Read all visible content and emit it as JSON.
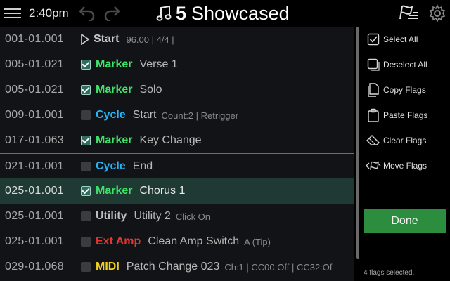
{
  "header": {
    "time": "2:40pm",
    "setlist_number": "5",
    "setlist_title": "Showcased"
  },
  "rows": [
    {
      "time": "001-01.001",
      "type": "Start",
      "type_color": "#c9c9c9",
      "name": "",
      "detail": "96.00 | 4/4 |",
      "checkbox": "none",
      "selected": false
    },
    {
      "time": "005-01.021",
      "type": "Marker",
      "type_color": "#3fe36a",
      "name": "Verse 1",
      "detail": "",
      "checkbox": "checked",
      "selected": false
    },
    {
      "time": "005-01.021",
      "type": "Marker",
      "type_color": "#3fe36a",
      "name": "Solo",
      "detail": "",
      "checkbox": "checked",
      "selected": false
    },
    {
      "time": "009-01.001",
      "type": "Cycle",
      "type_color": "#27b4f5",
      "name": "Start",
      "detail": "Count:2 | Retrigger",
      "checkbox": "unchecked",
      "selected": false
    },
    {
      "time": "017-01.063",
      "type": "Marker",
      "type_color": "#3fe36a",
      "name": "Key Change",
      "detail": "",
      "checkbox": "checked",
      "selected": false
    },
    {
      "time": "021-01.001",
      "type": "Cycle",
      "type_color": "#27b4f5",
      "name": "End",
      "detail": "",
      "checkbox": "unchecked",
      "selected": false
    },
    {
      "time": "025-01.001",
      "type": "Marker",
      "type_color": "#3fe36a",
      "name": "Chorus 1",
      "detail": "",
      "checkbox": "checked",
      "selected": true
    },
    {
      "time": "025-01.001",
      "type": "Utility",
      "type_color": "#bdbdbd",
      "name": "Utility 2",
      "detail": "Click On",
      "checkbox": "unchecked",
      "selected": false
    },
    {
      "time": "025-01.001",
      "type": "Ext Amp",
      "type_color": "#e8342c",
      "name": "Clean Amp Switch",
      "detail": "A (Tip)",
      "checkbox": "unchecked",
      "selected": false
    },
    {
      "time": "029-01.068",
      "type": "MIDI",
      "type_color": "#f2d21c",
      "name": "Patch Change 023",
      "detail": "Ch:1 | CC00:Off | CC32:Of",
      "checkbox": "unchecked",
      "selected": false
    }
  ],
  "side_panel": {
    "items": [
      {
        "label": "Select All",
        "icon": "select-all-icon"
      },
      {
        "label": "Deselect All",
        "icon": "deselect-all-icon"
      },
      {
        "label": "Copy Flags",
        "icon": "copy-icon"
      },
      {
        "label": "Paste Flags",
        "icon": "paste-icon"
      },
      {
        "label": "Clear Flags",
        "icon": "eraser-icon"
      },
      {
        "label": "Move Flags",
        "icon": "move-flags-icon"
      }
    ],
    "done_label": "Done",
    "status_text": "4 flags selected."
  },
  "colors": {
    "accent_green": "#2c8d3f",
    "selected_row": "#1e3a33",
    "divider_blue": "#3a78b8"
  }
}
